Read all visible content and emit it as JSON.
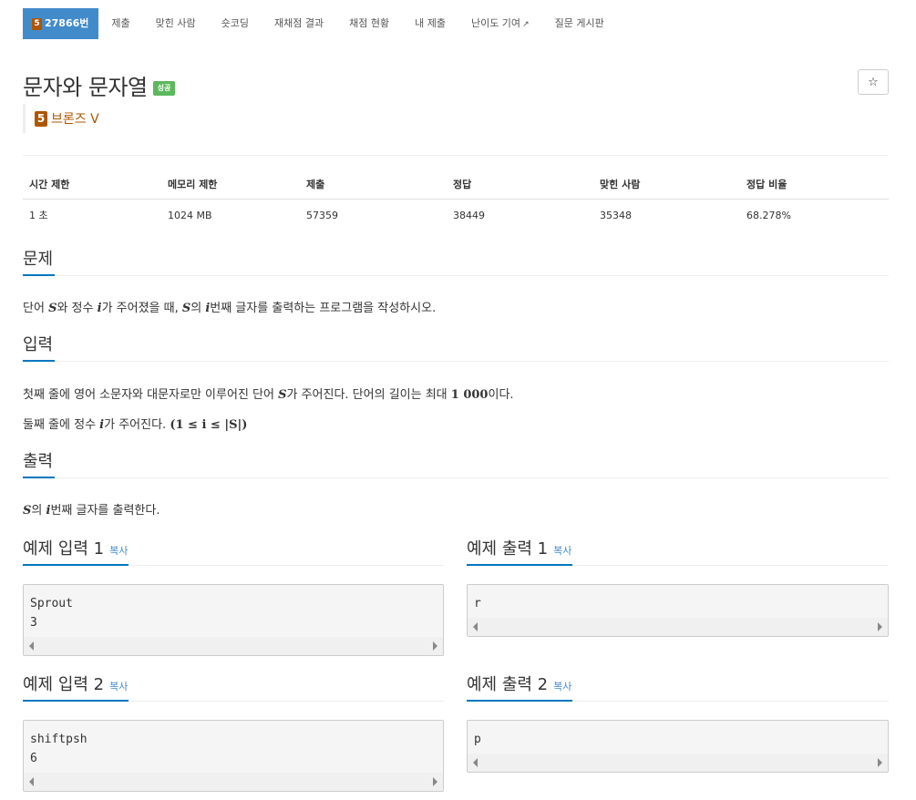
{
  "nav": {
    "problem_tier": "5",
    "problem_id": "27866번",
    "items": [
      "제출",
      "맞힌 사람",
      "숏코딩",
      "재채점 결과",
      "채점 현황",
      "내 제출",
      "난이도 기여",
      "질문 게시판"
    ]
  },
  "problem": {
    "title": "문자와 문자열",
    "status_badge": "성공",
    "star": "☆",
    "tier_number": "5",
    "tier_label": "브론즈 V"
  },
  "info": {
    "headers": [
      "시간 제한",
      "메모리 제한",
      "제출",
      "정답",
      "맞힌 사람",
      "정답 비율"
    ],
    "values": [
      "1 초",
      "1024 MB",
      "57359",
      "38449",
      "35348",
      "68.278%"
    ]
  },
  "sections": {
    "problem_title": "문제",
    "problem_text": {
      "p1": "단어 ",
      "S": "S",
      "p2": "와 정수 ",
      "i": "i",
      "p3": "가 주어졌을 때, ",
      "S2": "S",
      "p4": "의 ",
      "i2": "i",
      "p5": "번째 글자를 출력하는 프로그램을 작성하시오."
    },
    "input_title": "입력",
    "input_line1": {
      "p1": "첫째 줄에 영어 소문자와 대문자로만 이루어진 단어 ",
      "S": "S",
      "p2": "가 주어진다. 단어의 길이는 최대 ",
      "n": "1 000",
      "p3": "이다."
    },
    "input_line2": {
      "p1": "둘째 줄에 정수 ",
      "i": "i",
      "p2": "가 주어진다. ",
      "expr": "(1 ≤ i ≤ |S|)"
    },
    "output_title": "출력",
    "output_text": {
      "S": "S",
      "p1": "의 ",
      "i": "i",
      "p2": "번째 글자를 출력한다."
    }
  },
  "samples": {
    "copy_label": "복사",
    "in1_title": "예제 입력 1",
    "in1": "Sprout\n3",
    "out1_title": "예제 출력 1",
    "out1": "r",
    "in2_title": "예제 입력 2",
    "in2": "shiftpsh\n6",
    "out2_title": "예제 출력 2",
    "out2": "p"
  },
  "colors": {
    "nav_active": "#428bca",
    "success": "#5cb85c",
    "bronze": "#ad5600",
    "section_underline": "#0076c0"
  }
}
